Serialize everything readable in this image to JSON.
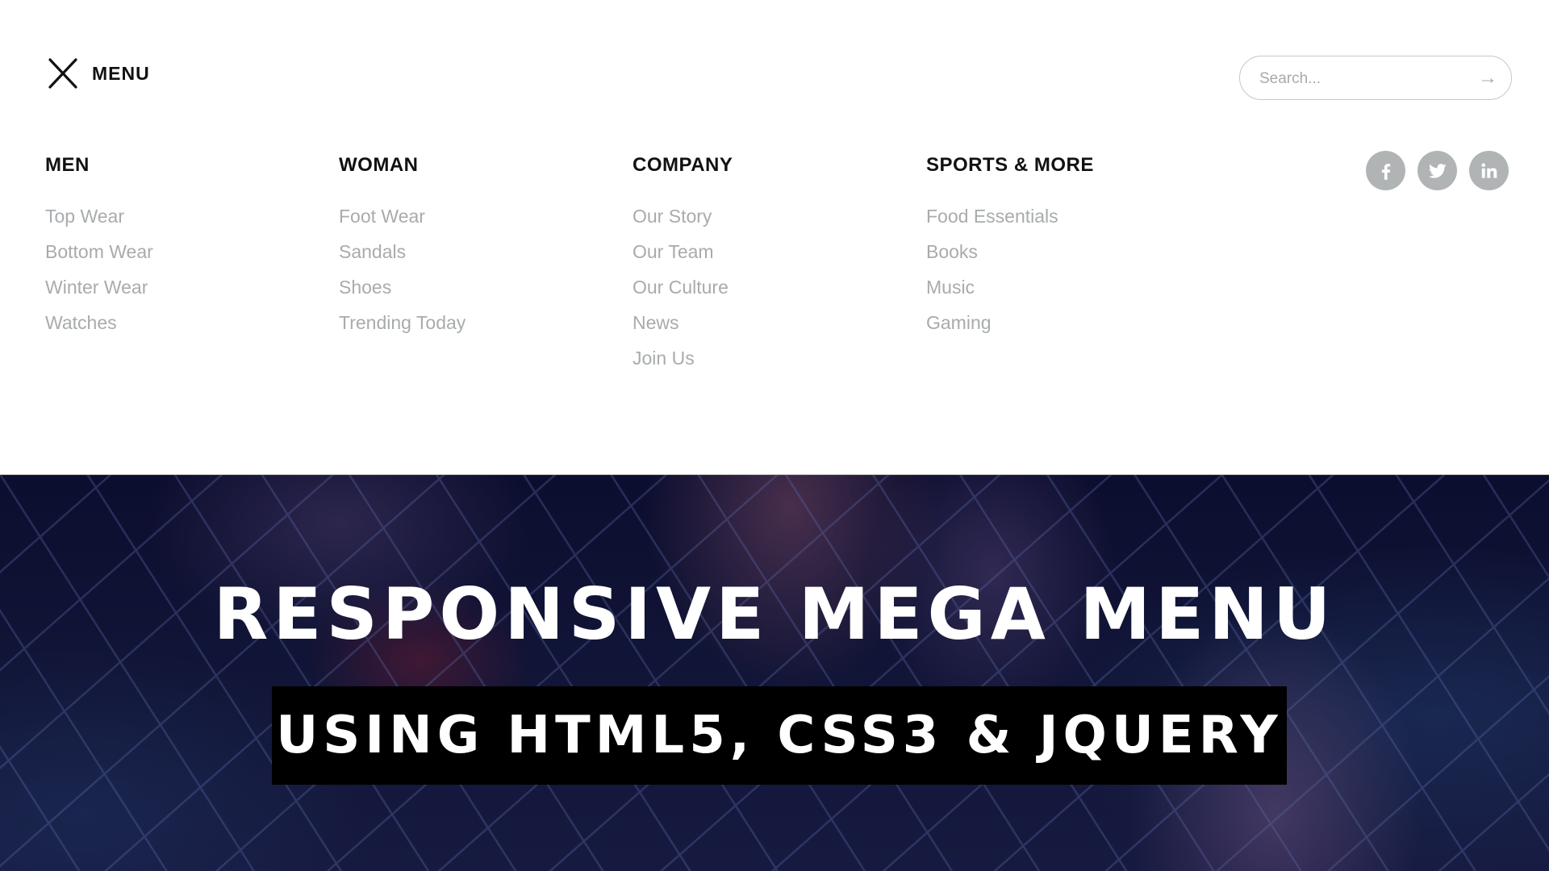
{
  "menu": {
    "toggle_label": "MENU",
    "toggle_icon": "close-icon"
  },
  "search": {
    "placeholder": "Search...",
    "value": "",
    "submit_icon": "arrow-right-icon"
  },
  "columns": [
    {
      "title": "MEN",
      "items": [
        "Top Wear",
        "Bottom Wear",
        "Winter Wear",
        "Watches"
      ]
    },
    {
      "title": "WOMAN",
      "items": [
        "Foot Wear",
        "Sandals",
        "Shoes",
        "Trending Today"
      ]
    },
    {
      "title": "COMPANY",
      "items": [
        "Our Story",
        "Our Team",
        "Our Culture",
        "News",
        "Join Us"
      ]
    },
    {
      "title": "SPORTS & MORE",
      "items": [
        "Food Essentials",
        "Books",
        "Music",
        "Gaming"
      ]
    }
  ],
  "social": [
    {
      "name": "facebook",
      "icon": "facebook-icon"
    },
    {
      "name": "twitter",
      "icon": "twitter-icon"
    },
    {
      "name": "linkedin",
      "icon": "linkedin-icon"
    }
  ],
  "hero": {
    "title": "RESPONSIVE MEGA MENU",
    "subtitle": "USING HTML5, CSS3 & JQUERY"
  },
  "colors": {
    "heading": "#111111",
    "link": "#a8abad",
    "social_bg": "#b1b4b5",
    "hero_overlay": "#0c0e2f",
    "subtitle_box": "#000000"
  }
}
